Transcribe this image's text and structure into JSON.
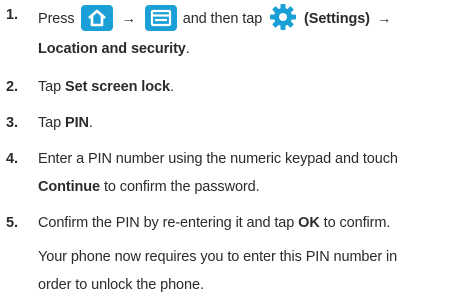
{
  "steps": [
    {
      "number": "1.",
      "line1_text_press": "Press",
      "arrow": "→",
      "line1_text_then": "and then tap",
      "settings_label": "(Settings)",
      "line2_bold": "Location and security",
      "line2_end": "."
    },
    {
      "number": "2.",
      "text_pre": "Tap",
      "bold": "Set screen lock",
      "text_post": "."
    },
    {
      "number": "3.",
      "text_pre": "Tap",
      "bold": "PIN",
      "text_post": "."
    },
    {
      "number": "4.",
      "line1": "Enter a PIN number using the numeric keypad and touch",
      "line2_bold": "Continue",
      "line2_rest": "to confirm the password."
    },
    {
      "number": "5.",
      "text_pre": "Confirm the PIN by re-entering it and tap",
      "bold": "OK",
      "text_post": "to confirm."
    }
  ],
  "note": {
    "line1": "Your phone now requires you to enter this PIN number in",
    "line2": "order to unlock the phone."
  },
  "icons": {
    "home": "home-icon",
    "menu": "menu-icon",
    "settings": "settings-gear-icon",
    "accent_color": "#1aa0d6"
  }
}
